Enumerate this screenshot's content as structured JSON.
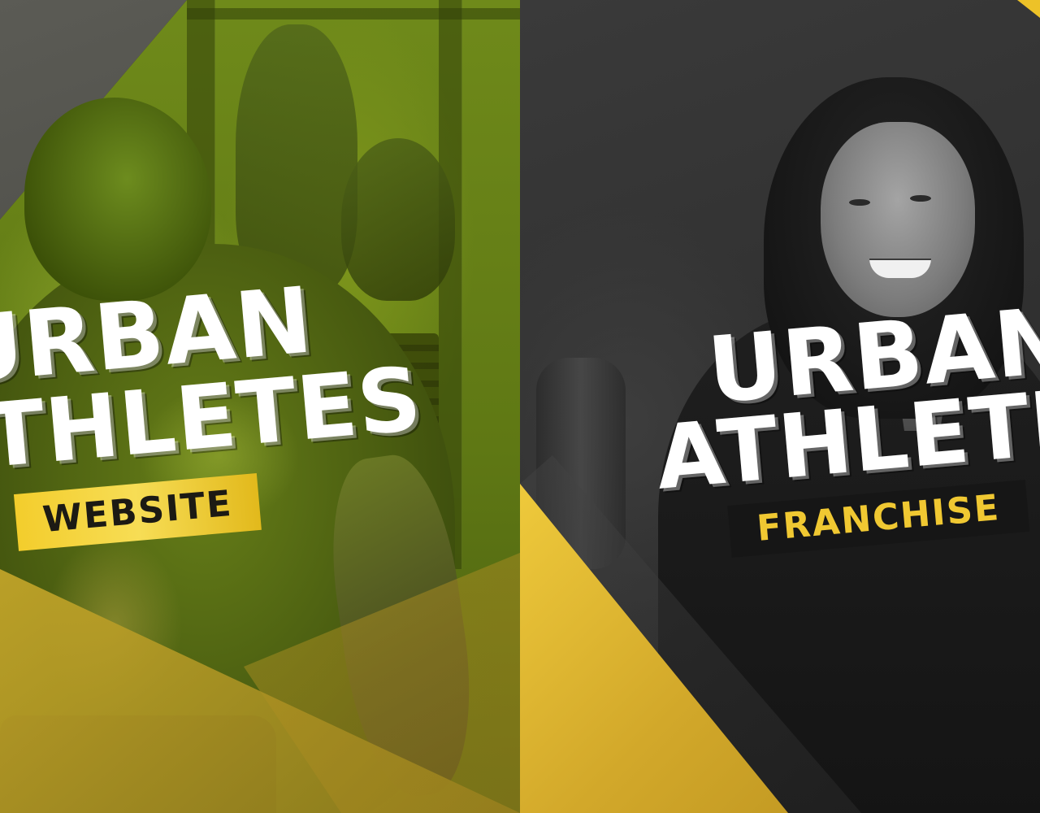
{
  "left_banner": {
    "title_line_1": "URBAN",
    "title_line_2": "ATHLETES",
    "ribbon_label": "WEBSITE",
    "colors": {
      "tint": "#6f8a1a",
      "ribbon": "#f3cd2c",
      "ribbon_text": "#1c1a14"
    }
  },
  "right_banner": {
    "title_line_1": "URBAN",
    "title_line_2": "ATHLETES",
    "ribbon_label": "FRANCHISE",
    "colors": {
      "tint": "#2e2e2e",
      "accent": "#f0c832",
      "ribbon_bg": "#161616"
    }
  }
}
